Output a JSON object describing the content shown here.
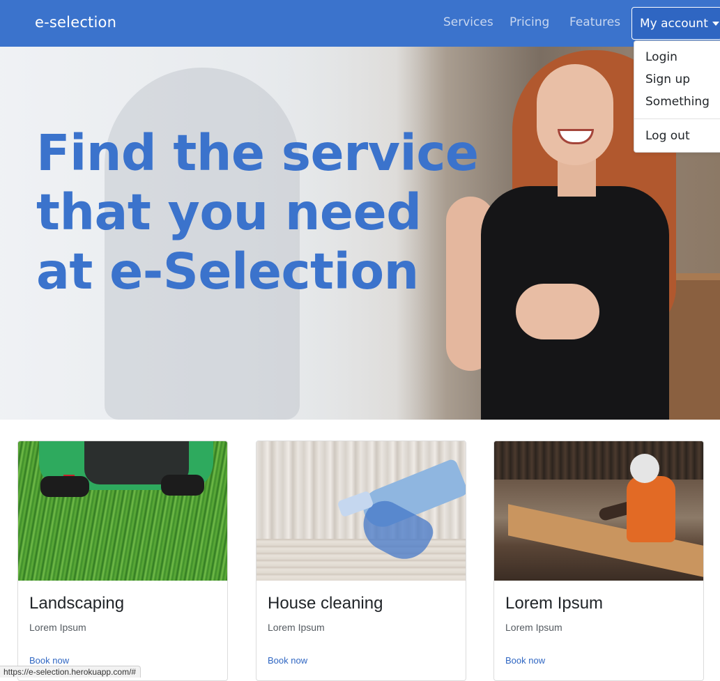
{
  "navbar": {
    "brand": "e-selection",
    "links": [
      "Services",
      "Pricing",
      "Features"
    ],
    "account_label": "My account",
    "colors": {
      "background": "#3b73cc",
      "link": "#c8d7f0",
      "active": "#ffffff"
    }
  },
  "account_menu": {
    "items": [
      "Login",
      "Sign up",
      "Something"
    ],
    "divider_item": "Log out"
  },
  "hero": {
    "title_lines": [
      "Find the service",
      "that you need",
      "at e-Selection"
    ],
    "title_color": "#3b73cc"
  },
  "cards": [
    {
      "title": "Landscaping",
      "text": "Lorem Ipsum",
      "link": "Book now",
      "image": "lawn-mower-on-grass"
    },
    {
      "title": "House cleaning",
      "text": "Lorem Ipsum",
      "link": "Book now",
      "image": "gloved-hand-with-spray-bottle"
    },
    {
      "title": "Lorem Ipsum",
      "text": "Lorem Ipsum",
      "link": "Book now",
      "image": "worker-in-carpentry-workshop"
    }
  ],
  "status_bar": {
    "url": "https://e-selection.herokuapp.com/#"
  }
}
